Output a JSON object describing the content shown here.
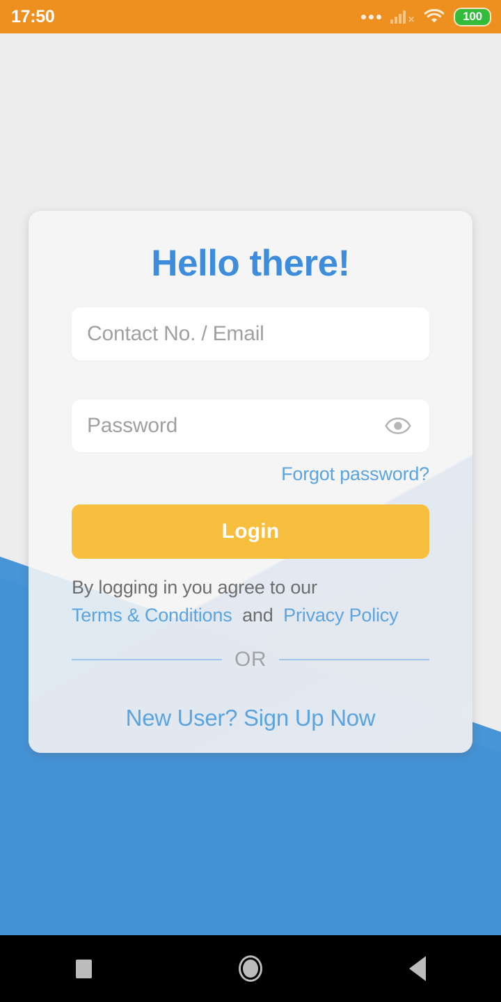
{
  "status_bar": {
    "time": "17:50",
    "battery_level": "100",
    "icons": [
      "more-dots-icon",
      "signal-no-service-icon",
      "wifi-icon",
      "battery-icon"
    ],
    "background_color": "#ed901f"
  },
  "card": {
    "title": "Hello there!",
    "title_color": "#3e8ddc"
  },
  "form": {
    "email": {
      "placeholder": "Contact No. / Email",
      "value": ""
    },
    "password": {
      "placeholder": "Password",
      "value": "",
      "toggle_icon": "eye-icon"
    },
    "forgot_password_label": "Forgot password?",
    "login_button_label": "Login",
    "login_button_color": "#f8bf3f"
  },
  "terms": {
    "intro": "By logging in you agree to our",
    "terms_link": "Terms & Conditions",
    "separator": "and",
    "privacy_link": "Privacy Policy"
  },
  "divider": {
    "label": "OR"
  },
  "signup": {
    "label": "New User? Sign Up Now"
  },
  "nav_bar": {
    "recents_label": "recents-square-icon",
    "home_label": "home-circle-icon",
    "back_label": "back-triangle-icon"
  },
  "theme": {
    "page_background": "#ededee",
    "accent_blue": "#4492d6",
    "link_blue": "#5ba4e0",
    "accent_amber": "#f8bf3f"
  }
}
